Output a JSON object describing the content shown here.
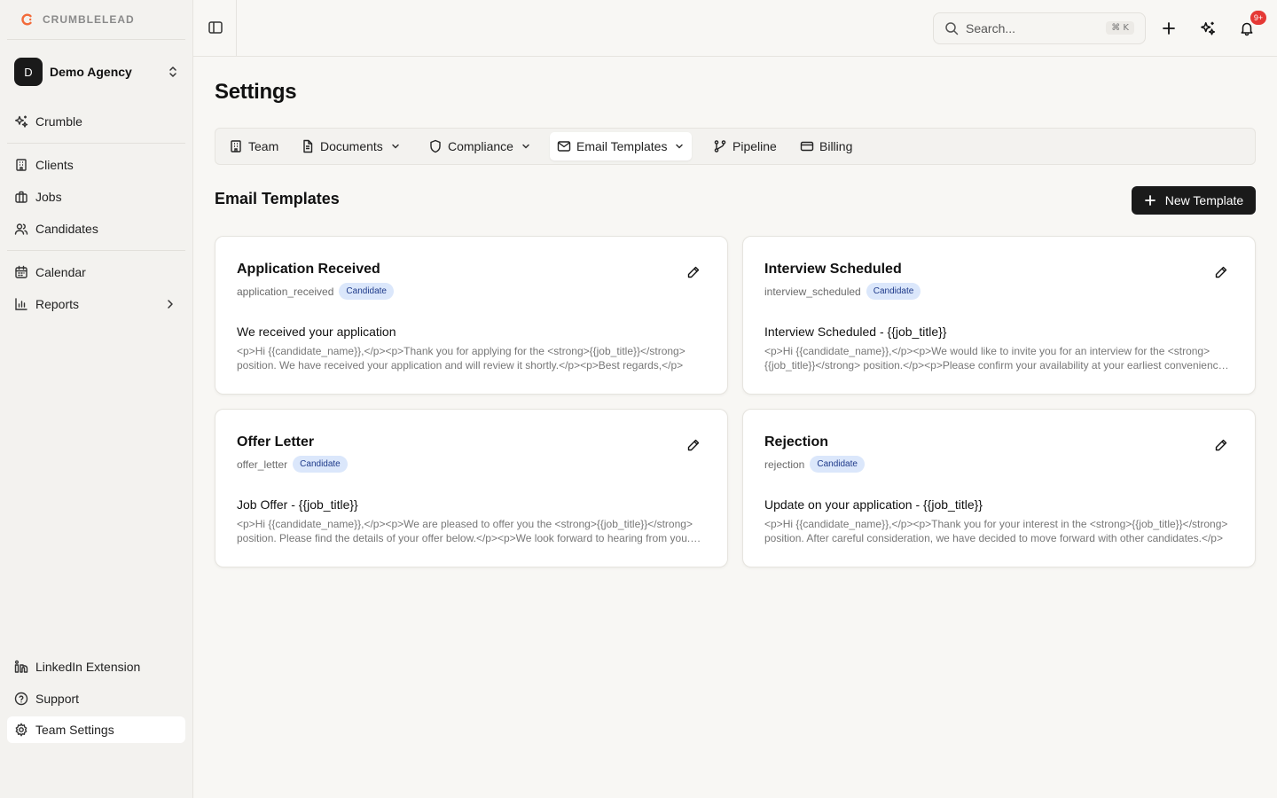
{
  "brand": {
    "name": "CRUMBLELEAD",
    "accent": "#f26b3a"
  },
  "workspace": {
    "initial": "D",
    "name": "Demo Agency"
  },
  "sidebar": {
    "groups": [
      [
        {
          "label": "Crumble",
          "icon": "sparkles-icon"
        }
      ],
      [
        {
          "label": "Clients",
          "icon": "building-icon"
        },
        {
          "label": "Jobs",
          "icon": "briefcase-icon"
        },
        {
          "label": "Candidates",
          "icon": "users-icon"
        }
      ],
      [
        {
          "label": "Calendar",
          "icon": "calendar-icon"
        },
        {
          "label": "Reports",
          "icon": "bar-chart-icon"
        }
      ]
    ],
    "bottom": [
      {
        "label": "LinkedIn Extension",
        "icon": "linkedin-icon"
      },
      {
        "label": "Support",
        "icon": "help-circle-icon"
      },
      {
        "label": "Team Settings",
        "icon": "gear-icon",
        "active": true
      }
    ]
  },
  "topbar": {
    "search_placeholder": "Search...",
    "shortcut": "⌘ K",
    "notifications_badge": "9+",
    "badge_color": "#e53935"
  },
  "page": {
    "title": "Settings"
  },
  "tabs": [
    {
      "label": "Team",
      "icon": "building-icon"
    },
    {
      "label": "Documents",
      "icon": "document-icon",
      "dropdown": true
    },
    {
      "label": "Compliance",
      "icon": "shield-icon",
      "dropdown": true
    },
    {
      "label": "Email Templates",
      "icon": "mail-icon",
      "dropdown": true,
      "active": true
    },
    {
      "label": "Pipeline",
      "icon": "git-branch-icon"
    },
    {
      "label": "Billing",
      "icon": "credit-card-icon"
    }
  ],
  "section": {
    "title": "Email Templates",
    "new_button": "New Template"
  },
  "templates": [
    {
      "name": "Application Received",
      "key": "application_received",
      "badge": "Candidate",
      "subject": "We received your application",
      "body": "<p>Hi {{candidate_name}},</p><p>Thank you for applying for the <strong>{{job_title}}</strong> position. We have received your application and will review it shortly.</p><p>Best regards,</p>"
    },
    {
      "name": "Interview Scheduled",
      "key": "interview_scheduled",
      "badge": "Candidate",
      "subject": "Interview Scheduled - {{job_title}}",
      "body": "<p>Hi {{candidate_name}},</p><p>We would like to invite you for an interview for the <strong>{{job_title}}</strong> position.</p><p>Please confirm your availability at your earliest convenience.</p>"
    },
    {
      "name": "Offer Letter",
      "key": "offer_letter",
      "badge": "Candidate",
      "subject": "Job Offer - {{job_title}}",
      "body": "<p>Hi {{candidate_name}},</p><p>We are pleased to offer you the <strong>{{job_title}}</strong> position. Please find the details of your offer below.</p><p>We look forward to hearing from you.</p>"
    },
    {
      "name": "Rejection",
      "key": "rejection",
      "badge": "Candidate",
      "subject": "Update on your application - {{job_title}}",
      "body": "<p>Hi {{candidate_name}},</p><p>Thank you for your interest in the <strong>{{job_title}}</strong> position. After careful consideration, we have decided to move forward with other candidates.</p>"
    }
  ]
}
